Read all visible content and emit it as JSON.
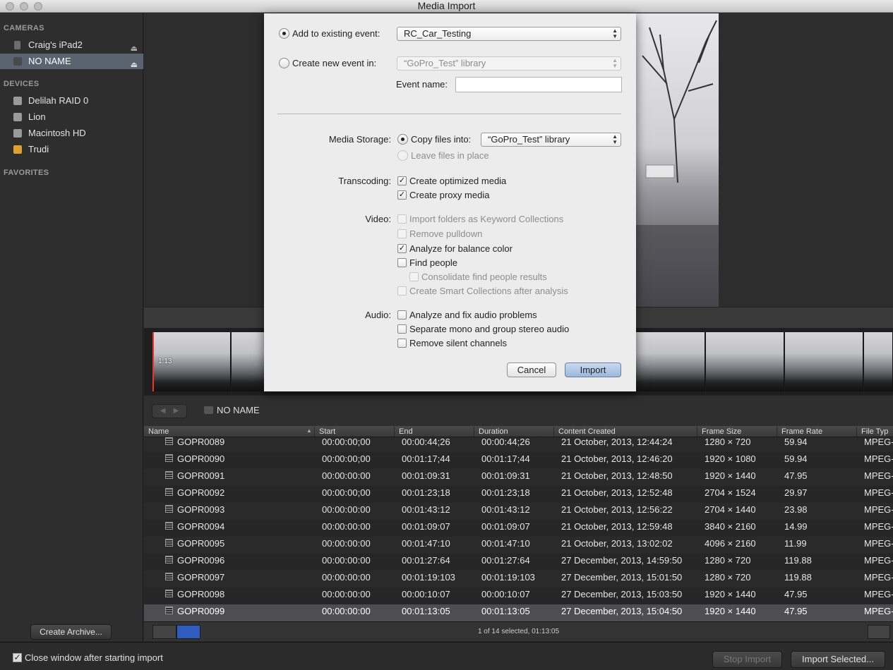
{
  "window": {
    "title": "Media Import"
  },
  "sidebar": {
    "cameras_header": "CAMERAS",
    "cameras": [
      {
        "label": "Craig's iPad2",
        "eject": "⏏"
      },
      {
        "label": "NO NAME",
        "eject": "⏏",
        "selected": true
      }
    ],
    "devices_header": "DEVICES",
    "devices": [
      {
        "label": "Delilah RAID 0"
      },
      {
        "label": "Lion"
      },
      {
        "label": "Macintosh HD"
      },
      {
        "label": "Trudi"
      }
    ],
    "favorites_header": "FAVORITES",
    "create_archive": "Create Archive..."
  },
  "filmstrip": {
    "timecode": "1:13"
  },
  "browser": {
    "location": "NO NAME",
    "back": "◀",
    "forward": "▶",
    "columns": [
      "Name",
      "Start",
      "End",
      "Duration",
      "Content Created",
      "Frame Size",
      "Frame Rate",
      "File Typ"
    ],
    "rows": [
      {
        "name": "GOPR0089",
        "start": "00:00:00;00",
        "end": "00:00:44;26",
        "duration": "00:00:44;26",
        "created": "21  October, 2013, 12:44:24",
        "size": "1280 × 720",
        "rate": "59.94",
        "type": "MPEG-"
      },
      {
        "name": "GOPR0090",
        "start": "00:00:00;00",
        "end": "00:01:17;44",
        "duration": "00:01:17;44",
        "created": "21  October, 2013, 12:46:20",
        "size": "1920 × 1080",
        "rate": "59.94",
        "type": "MPEG-"
      },
      {
        "name": "GOPR0091",
        "start": "00:00:00:00",
        "end": "00:01:09:31",
        "duration": "00:01:09:31",
        "created": "21  October, 2013, 12:48:50",
        "size": "1920 × 1440",
        "rate": "47.95",
        "type": "MPEG-"
      },
      {
        "name": "GOPR0092",
        "start": "00:00:00;00",
        "end": "00:01:23;18",
        "duration": "00:01:23;18",
        "created": "21  October, 2013, 12:52:48",
        "size": "2704 × 1524",
        "rate": "29.97",
        "type": "MPEG-"
      },
      {
        "name": "GOPR0093",
        "start": "00:00:00:00",
        "end": "00:01:43:12",
        "duration": "00:01:43:12",
        "created": "21  October, 2013, 12:56:22",
        "size": "2704 × 1440",
        "rate": "23.98",
        "type": "MPEG-"
      },
      {
        "name": "GOPR0094",
        "start": "00:00:00:00",
        "end": "00:01:09:07",
        "duration": "00:01:09:07",
        "created": "21  October, 2013, 12:59:48",
        "size": "3840 × 2160",
        "rate": "14.99",
        "type": "MPEG-"
      },
      {
        "name": "GOPR0095",
        "start": "00:00:00:00",
        "end": "00:01:47:10",
        "duration": "00:01:47:10",
        "created": "21  October, 2013, 13:02:02",
        "size": "4096 × 2160",
        "rate": "11.99",
        "type": "MPEG-"
      },
      {
        "name": "GOPR0096",
        "start": "00:00:00:00",
        "end": "00:01:27:64",
        "duration": "00:01:27:64",
        "created": "27  December, 2013, 14:59:50",
        "size": "1280 × 720",
        "rate": "119.88",
        "type": "MPEG-"
      },
      {
        "name": "GOPR0097",
        "start": "00:00:00:00",
        "end": "00:01:19:103",
        "duration": "00:01:19:103",
        "created": "27  December, 2013, 15:01:50",
        "size": "1280 × 720",
        "rate": "119.88",
        "type": "MPEG-"
      },
      {
        "name": "GOPR0098",
        "start": "00:00:00:00",
        "end": "00:00:10:07",
        "duration": "00:00:10:07",
        "created": "27  December, 2013, 15:03:50",
        "size": "1920 × 1440",
        "rate": "47.95",
        "type": "MPEG-"
      },
      {
        "name": "GOPR0099",
        "start": "00:00:00:00",
        "end": "00:01:13:05",
        "duration": "00:01:13:05",
        "created": "27  December, 2013, 15:04:50",
        "size": "1920 × 1440",
        "rate": "47.95",
        "type": "MPEG-",
        "selected": true
      }
    ],
    "status": "1 of 14 selected, 01:13:05"
  },
  "footer": {
    "close_after_import": "Close window after starting import",
    "close_checked": "✓",
    "stop_import": "Stop Import",
    "import_selected": "Import Selected..."
  },
  "dialog": {
    "add_existing_label": "Add to existing event:",
    "existing_event_value": "RC_Car_Testing",
    "create_new_label": "Create new event in:",
    "new_event_library": "“GoPro_Test” library",
    "event_name_label": "Event name:",
    "event_name_value": "",
    "media_storage_label": "Media Storage:",
    "copy_files_label": "Copy files into:",
    "copy_files_library": "“GoPro_Test” library",
    "leave_in_place_label": "Leave files in place",
    "transcoding_label": "Transcoding:",
    "create_optimized": "Create optimized media",
    "create_proxy": "Create proxy media",
    "video_label": "Video:",
    "import_folders_keywords": "Import folders as Keyword Collections",
    "remove_pulldown": "Remove pulldown",
    "analyze_balance": "Analyze for balance color",
    "find_people": "Find people",
    "consolidate_people": "Consolidate find people results",
    "smart_collections": "Create Smart Collections after analysis",
    "audio_label": "Audio:",
    "analyze_audio": "Analyze and fix audio problems",
    "separate_mono": "Separate mono and group stereo audio",
    "remove_silent": "Remove silent channels",
    "cancel": "Cancel",
    "import": "Import",
    "checkmark": "✓"
  }
}
